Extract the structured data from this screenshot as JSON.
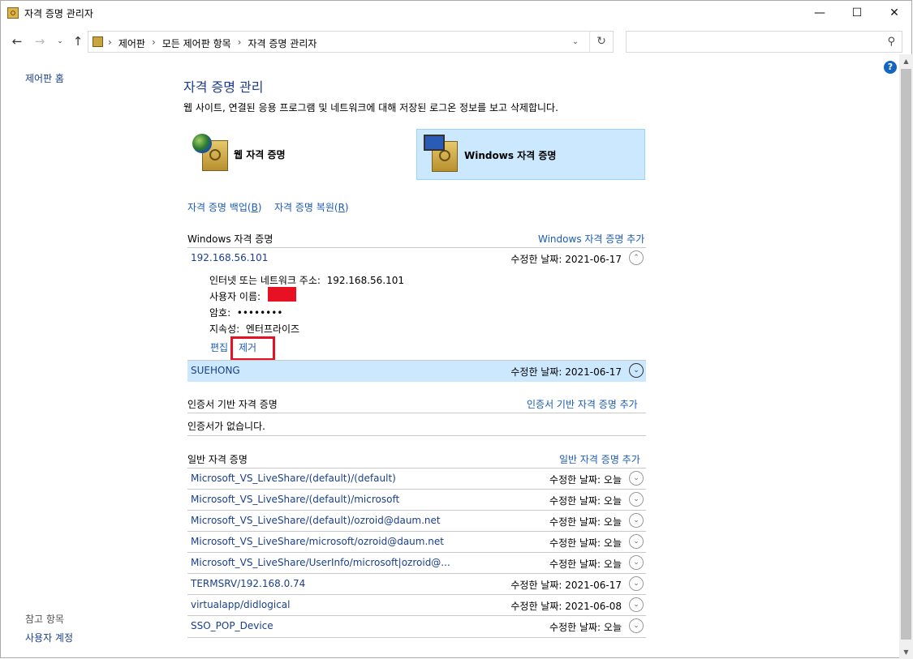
{
  "window": {
    "title": "자격 증명 관리자"
  },
  "address": {
    "crumbs": [
      "제어판",
      "모든 제어판 항목",
      "자격 증명 관리자"
    ]
  },
  "search": {
    "placeholder": ""
  },
  "sidebar": {
    "home": "제어판 홈",
    "see_also": "참고 항목",
    "user_accounts": "사용자 계정"
  },
  "main": {
    "title": "자격 증명 관리",
    "description": "웹 사이트, 연결된 응용 프로그램 및 네트워크에 대해 저장된 로그온 정보를 보고 삭제합니다.",
    "web_cred": "웹 자격 증명",
    "windows_cred": "Windows 자격 증명",
    "backup": "자격 증명 백업(",
    "backup_key": "B",
    "backup_end": ")",
    "restore": "자격 증명 복원(",
    "restore_key": "R",
    "restore_end": ")"
  },
  "windows_section": {
    "title": "Windows 자격 증명",
    "add": "Windows 자격 증명 추가",
    "expanded": {
      "name": "192.168.56.101",
      "date": "수정한 날짜:  2021-06-17",
      "address_label": "인터넷 또는 네트워크 주소:",
      "address_value": "192.168.56.101",
      "user_label": "사용자 이름:",
      "password_label": "암호:",
      "password_value": "••••••••",
      "persist_label": "지속성:",
      "persist_value": "엔터프라이즈",
      "edit": "편집",
      "remove": "제거"
    },
    "selected": {
      "name": "SUEHONG",
      "date": "수정한 날짜:  2021-06-17"
    }
  },
  "cert_section": {
    "title": "인증서 기반 자격 증명",
    "add": "인증서 기반 자격 증명 추가",
    "empty": "인증서가 없습니다."
  },
  "generic_section": {
    "title": "일반 자격 증명",
    "add": "일반 자격 증명 추가",
    "items": [
      {
        "name": "Microsoft_VS_LiveShare/(default)/(default)",
        "date": "수정한 날짜:  오늘"
      },
      {
        "name": "Microsoft_VS_LiveShare/(default)/microsoft",
        "date": "수정한 날짜:  오늘"
      },
      {
        "name": "Microsoft_VS_LiveShare/(default)/ozroid@daum.net",
        "date": "수정한 날짜:  오늘"
      },
      {
        "name": "Microsoft_VS_LiveShare/microsoft/ozroid@daum.net",
        "date": "수정한 날짜:  오늘"
      },
      {
        "name": "Microsoft_VS_LiveShare/UserInfo/microsoft|ozroid@...",
        "date": "수정한 날짜:  오늘"
      },
      {
        "name": "TERMSRV/192.168.0.74",
        "date": "수정한 날짜:  2021-06-17"
      },
      {
        "name": "virtualapp/didlogical",
        "date": "수정한 날짜:  2021-06-08"
      },
      {
        "name": "SSO_POP_Device",
        "date": "수정한 날짜:  오늘"
      }
    ]
  },
  "colors": {
    "accent_link": "#1a5bb8",
    "selection": "#cce8ff",
    "highlight": "#e81123"
  }
}
